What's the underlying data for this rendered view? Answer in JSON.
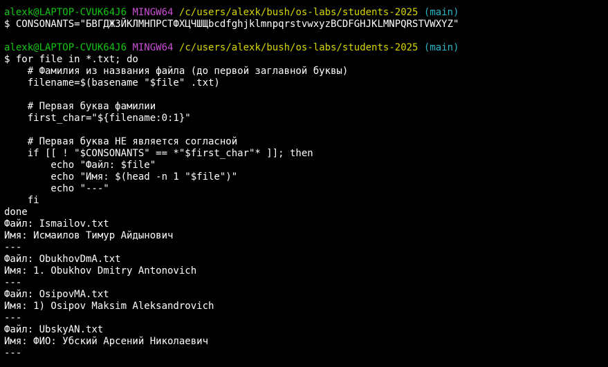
{
  "colors": {
    "background": "#000000",
    "text": "#ffffff",
    "user_host": "#14c614",
    "mingw": "#c84fd4",
    "path": "#d6d600",
    "branch": "#2ab6c8"
  },
  "prompt1": {
    "user_host": "alexk@LAPTOP-CVUK64J6",
    "system": "MINGW64",
    "path": "/c/users/alexk/bush/os-labs/students-2025",
    "branch": "(main)"
  },
  "cmd1": "$ CONSONANTS=\"БВГДЖЗЙКЛМНПРСТФХЦЧШЩbcdfghjklmnpqrstvwxyzBCDFGHJKLMNPQRSTVWXYZ\"",
  "prompt2": {
    "user_host": "alexk@LAPTOP-CVUK64J6",
    "system": "MINGW64",
    "path": "/c/users/alexk/bush/os-labs/students-2025",
    "branch": "(main)"
  },
  "script_lines": [
    "$ for file in *.txt; do",
    "    # Фамилия из названия файла (до первой заглавной буквы)",
    "    filename=$(basename \"$file\" .txt)",
    "",
    "    # Первая буква фамилии",
    "    first_char=\"${filename:0:1}\"",
    "",
    "    # Первая буква НЕ является согласной",
    "    if [[ ! \"$CONSONANTS\" == *\"$first_char\"* ]]; then",
    "        echo \"Файл: $file\"",
    "        echo \"Имя: $(head -n 1 \"$file\")\"",
    "        echo \"---\"",
    "    fi",
    "done"
  ],
  "output_lines": [
    "Файл: Ismailov.txt",
    "Имя: Исмаилов Тимур Айдынович",
    "---",
    "Файл: ObukhovDmA.txt",
    "Имя: 1. Obukhov Dmitry Antonovich",
    "---",
    "Файл: OsipovMA.txt",
    "Имя: 1) Osipov Maksim Aleksandrovich",
    "---",
    "Файл: UbskyAN.txt",
    "Имя: ФИО: Убский Арсений Николаевич",
    "---"
  ]
}
